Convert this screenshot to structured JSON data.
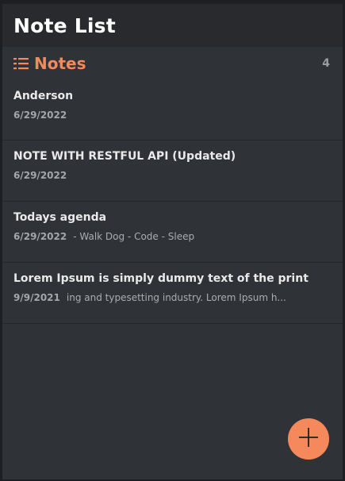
{
  "header": {
    "title": "Note List"
  },
  "section": {
    "icon": "list-icon",
    "title": "Notes",
    "count": "4"
  },
  "notes": [
    {
      "title": "Anderson",
      "date": "6/29/2022",
      "preview": ""
    },
    {
      "title": "NOTE WITH RESTFUL API (Updated)",
      "date": "6/29/2022",
      "preview": ""
    },
    {
      "title": "Todays agenda",
      "date": "6/29/2022",
      "preview": "- Walk Dog - Code - Sleep"
    },
    {
      "title": "Lorem Ipsum is simply dummy text of the print",
      "date": "9/9/2021",
      "preview": "ing and typesetting industry. Lorem Ipsum h..."
    }
  ],
  "fab": {
    "icon": "plus-icon"
  },
  "colors": {
    "accent": "#f5895b",
    "background": "#2f3236",
    "header": "#282a2e"
  }
}
